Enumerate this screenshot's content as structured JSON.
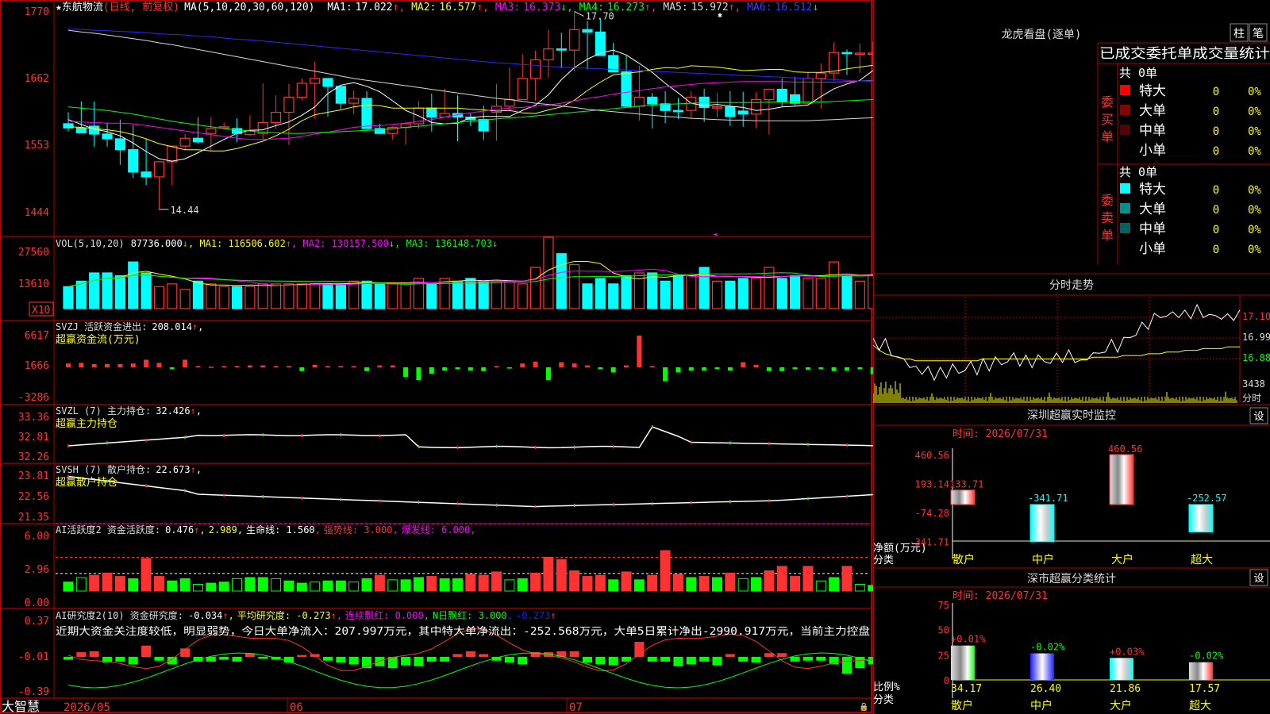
{
  "colors": {
    "red": "#ff3232",
    "cyan": "#00ffff",
    "green": "#00ff00",
    "yellow": "#ffff00",
    "magenta": "#ff00ff",
    "blue": "#1e1eff",
    "white": "#ffffff",
    "frame": "#b00000"
  },
  "main": {
    "title": "★东航物流",
    "mode": "(日线, 前复权)",
    "ma_label": "MA(5,10,20,30,60,120)",
    "ma": [
      {
        "label": "MA1:",
        "value": "17.022",
        "arrow": "↑"
      },
      {
        "label": "MA2:",
        "value": "16.577",
        "arrow": "↑"
      },
      {
        "label": "MA3:",
        "value": "16.373",
        "arrow": "↓"
      },
      {
        "label": "MA4:",
        "value": "16.273",
        "arrow": "↑"
      },
      {
        "label": "MA5:",
        "value": "15.972",
        "arrow": "↑"
      },
      {
        "label": "MA6:",
        "value": "16.512",
        "arrow": "↓"
      }
    ],
    "y_ticks": [
      "1770",
      "1662",
      "1553",
      "1444"
    ],
    "high_mark": "17.70",
    "low_mark": "14.44",
    "brand": "大智慧",
    "x_labels": [
      "2026/05",
      "06",
      "07"
    ]
  },
  "candles": {
    "o": [
      15.86,
      15.79,
      15.82,
      15.69,
      15.61,
      15.43,
      15.06,
      14.98,
      15.23,
      15.49,
      15.62,
      15.7,
      15.81,
      15.78,
      15.68,
      15.7,
      15.88,
      16.05,
      16.3,
      16.53,
      16.61,
      16.48,
      16.2,
      16.28,
      15.78,
      15.7,
      15.8,
      15.86,
      16.12,
      15.97,
      16.03,
      15.97,
      15.93,
      16.05,
      16.15,
      16.26,
      16.61,
      16.92,
      17.1,
      17.08,
      17.42,
      17.38,
      16.99,
      16.72,
      16.15,
      16.3,
      16.19,
      16.08,
      16.08,
      16.3,
      16.13,
      16.14,
      16.07,
      16.02,
      16.26,
      16.43,
      16.34,
      16.2,
      16.61,
      16.7,
      17.04,
      17.03,
      17.03,
      17.03,
      16.99
    ],
    "h": [
      16.05,
      16.23,
      16.23,
      15.88,
      15.93,
      15.84,
      15.61,
      15.1,
      15.3,
      15.69,
      15.97,
      15.97,
      15.88,
      15.95,
      16.0,
      16.53,
      16.33,
      16.52,
      16.61,
      16.89,
      16.61,
      16.48,
      16.41,
      16.4,
      15.86,
      15.82,
      15.89,
      16.24,
      16.36,
      16.44,
      16.33,
      16.03,
      16.16,
      16.52,
      16.79,
      17.01,
      17.07,
      17.42,
      17.37,
      17.72,
      17.56,
      17.61,
      17.2,
      16.99,
      16.82,
      16.37,
      16.4,
      16.29,
      16.4,
      16.44,
      16.37,
      16.4,
      16.39,
      16.38,
      16.37,
      16.61,
      16.64,
      16.71,
      16.86,
      17.21,
      17.09,
      17.19,
      17.22,
      17.32,
      17.19
    ],
    "l": [
      15.73,
      15.71,
      15.48,
      15.48,
      15.18,
      14.96,
      14.84,
      14.44,
      14.84,
      15.42,
      15.53,
      15.42,
      15.78,
      15.56,
      15.66,
      15.59,
      15.77,
      15.51,
      16.25,
      15.95,
      15.98,
      16.11,
      16.02,
      15.85,
      15.7,
      15.59,
      15.51,
      15.78,
      15.73,
      15.98,
      15.57,
      15.82,
      15.59,
      15.58,
      16.07,
      16.26,
      16.24,
      16.63,
      16.78,
      16.73,
      16.76,
      17.03,
      16.81,
      16.52,
      15.91,
      15.78,
      15.87,
      15.94,
      15.95,
      15.89,
      15.96,
      15.82,
      15.81,
      15.79,
      15.68,
      16.15,
      16.16,
      16.17,
      16.11,
      16.57,
      16.67,
      16.7,
      16.84,
      16.81,
      16.89
    ],
    "c": [
      15.79,
      15.71,
      15.69,
      15.61,
      15.43,
      15.06,
      14.98,
      15.23,
      15.49,
      15.62,
      15.56,
      15.78,
      15.81,
      15.7,
      15.75,
      15.88,
      16.05,
      16.3,
      16.53,
      16.61,
      16.48,
      16.2,
      16.28,
      15.78,
      15.7,
      15.8,
      15.86,
      16.12,
      15.97,
      16.03,
      15.97,
      15.93,
      15.74,
      16.15,
      16.26,
      16.61,
      16.92,
      17.1,
      17.08,
      17.42,
      17.38,
      16.99,
      16.72,
      16.15,
      16.3,
      16.19,
      16.08,
      16.06,
      16.3,
      16.13,
      16.14,
      15.98,
      16.02,
      16.26,
      16.43,
      16.23,
      16.2,
      16.61,
      16.7,
      17.04,
      17.03,
      17.03,
      17.03,
      16.99,
      17.09
    ]
  },
  "ma_lines": {
    "ma1": [
      15.93,
      15.85,
      15.77,
      15.73,
      15.66,
      15.54,
      15.4,
      15.28,
      15.24,
      15.28,
      15.38,
      15.49,
      15.6,
      15.7,
      15.75,
      15.76,
      15.83,
      15.89,
      16.0,
      16.14,
      16.36,
      16.5,
      16.54,
      16.48,
      16.39,
      16.24,
      16.08,
      15.99,
      15.88,
      15.86,
      15.87,
      15.96,
      15.98,
      15.98,
      15.98,
      16.08,
      16.17,
      16.34,
      16.59,
      16.79,
      16.93,
      17.03,
      17.08,
      17.0,
      16.86,
      16.71,
      16.53,
      16.37,
      16.2,
      16.16,
      16.18,
      16.15,
      16.13,
      16.08,
      16.1,
      16.14,
      16.15,
      16.17,
      16.31,
      16.44,
      16.52,
      16.58,
      16.74,
      16.88,
      16.99
    ],
    "ma2": [
      15.81,
      15.8,
      15.78,
      15.76,
      15.73,
      15.68,
      15.61,
      15.53,
      15.48,
      15.43,
      15.43,
      15.41,
      15.41,
      15.45,
      15.51,
      15.57,
      15.66,
      15.77,
      15.91,
      16.01,
      16.05,
      16.09,
      16.14,
      16.17,
      16.16,
      16.12,
      16.12,
      16.12,
      16.12,
      16.12,
      16.12,
      16.1,
      16.09,
      16.07,
      16.08,
      16.04,
      16.03,
      16.09,
      16.14,
      16.25,
      16.41,
      16.55,
      16.67,
      16.7,
      16.72,
      16.76,
      16.79,
      16.78,
      16.82,
      16.81,
      16.8,
      16.77,
      16.74,
      16.75,
      16.76,
      16.76,
      16.72,
      16.71,
      16.71,
      16.73,
      16.77,
      16.8,
      16.83,
      16.88,
      16.91
    ],
    "ma3": [
      15.9,
      15.89,
      15.88,
      15.87,
      15.87,
      15.86,
      15.83,
      15.8,
      15.77,
      15.74,
      15.71,
      15.68,
      15.65,
      15.62,
      15.6,
      15.6,
      15.61,
      15.62,
      15.65,
      15.69,
      15.72,
      15.76,
      15.8,
      15.82,
      15.83,
      15.85,
      15.87,
      15.9,
      15.93,
      15.97,
      16.01,
      16.04,
      16.07,
      16.1,
      16.12,
      16.13,
      16.15,
      16.17,
      16.2,
      16.24,
      16.28,
      16.31,
      16.35,
      16.38,
      16.41,
      16.44,
      16.47,
      16.49,
      16.51,
      16.53,
      16.54,
      16.55,
      16.56,
      16.56,
      16.56,
      16.56,
      16.55,
      16.55,
      16.55,
      16.55,
      16.56,
      16.57,
      16.58,
      16.59,
      16.6
    ],
    "ma4": [
      16.14,
      16.12,
      16.1,
      16.08,
      16.05,
      16.02,
      15.98,
      15.94,
      15.9,
      15.87,
      15.84,
      15.81,
      15.78,
      15.76,
      15.74,
      15.72,
      15.71,
      15.7,
      15.7,
      15.71,
      15.72,
      15.73,
      15.74,
      15.75,
      15.76,
      15.78,
      15.8,
      15.82,
      15.84,
      15.86,
      15.88,
      15.9,
      15.92,
      15.94,
      15.96,
      15.97,
      15.99,
      16.01,
      16.03,
      16.05,
      16.07,
      16.09,
      16.11,
      16.13,
      16.15,
      16.17,
      16.18,
      16.19,
      16.2,
      16.21,
      16.21,
      16.21,
      16.21,
      16.21,
      16.22,
      16.22,
      16.22,
      16.22,
      16.22,
      16.23,
      16.24,
      16.25,
      16.26,
      16.27,
      16.28
    ],
    "ma5": [
      17.41,
      17.38,
      17.36,
      17.33,
      17.3,
      17.27,
      17.24,
      17.2,
      17.17,
      17.13,
      17.09,
      17.05,
      17.01,
      16.97,
      16.93,
      16.89,
      16.85,
      16.81,
      16.77,
      16.73,
      16.69,
      16.65,
      16.61,
      16.58,
      16.55,
      16.52,
      16.49,
      16.46,
      16.43,
      16.4,
      16.37,
      16.34,
      16.31,
      16.28,
      16.26,
      16.23,
      16.2,
      16.18,
      16.15,
      16.13,
      16.1,
      16.08,
      16.06,
      16.04,
      16.02,
      16.0,
      15.98,
      15.97,
      15.95,
      15.94,
      15.93,
      15.92,
      15.92,
      15.91,
      15.91,
      15.91,
      15.91,
      15.91,
      15.92,
      15.93,
      15.94,
      15.95,
      15.96,
      15.97,
      15.98
    ],
    "ma6": [
      17.43,
      17.42,
      17.41,
      17.4,
      17.39,
      17.38,
      17.37,
      17.35,
      17.34,
      17.33,
      17.31,
      17.3,
      17.28,
      17.26,
      17.25,
      17.23,
      17.21,
      17.19,
      17.17,
      17.15,
      17.13,
      17.11,
      17.09,
      17.07,
      17.05,
      17.03,
      17.01,
      16.99,
      16.97,
      16.95,
      16.93,
      16.91,
      16.89,
      16.87,
      16.86,
      16.84,
      16.83,
      16.81,
      16.8,
      16.79,
      16.78,
      16.77,
      16.76,
      16.75,
      16.74,
      16.73,
      16.72,
      16.71,
      16.7,
      16.69,
      16.68,
      16.67,
      16.66,
      16.65,
      16.64,
      16.63,
      16.62,
      16.61,
      16.6,
      16.59,
      16.58,
      16.57,
      16.56,
      16.54,
      16.52
    ]
  },
  "vol_panel": {
    "title": "VOL(5,10,20)",
    "value": "87736.000",
    "arrow": "↓",
    "ma1": "MA1: 116506.602",
    "ma1_arrow": "↑",
    "ma2": "MA2: 130157.500",
    "ma2_arrow": "↓",
    "ma3": "MA3: 136148.703",
    "ma3_arrow": "↓",
    "y_ticks": [
      "27560",
      "13610"
    ],
    "unit": "X10",
    "values": [
      8,
      10,
      13,
      13,
      12,
      17,
      13,
      8,
      9,
      7,
      10,
      9,
      8,
      8,
      8,
      9,
      9,
      9,
      9,
      9,
      9,
      9,
      10,
      10,
      9,
      9,
      9,
      11,
      9,
      11,
      10,
      11,
      10,
      10,
      10,
      9,
      15,
      26,
      20,
      16,
      9,
      11,
      9,
      12,
      13,
      13,
      10,
      12,
      12,
      15,
      10,
      10,
      11,
      11,
      15,
      11,
      12,
      11,
      11,
      17,
      12,
      10,
      12,
      12,
      8
    ]
  },
  "svzj_panel": {
    "title": "SVZJ  活跃资金进出:",
    "value": "208.014",
    "arrow": "↑",
    "sub": "超赢资金流(万元)",
    "y_ticks": [
      "6617",
      "1666",
      "-3286"
    ],
    "values": [
      600,
      700,
      500,
      500,
      500,
      600,
      1200,
      700,
      -300,
      1200,
      200,
      100,
      200,
      200,
      300,
      300,
      200,
      200,
      -600,
      400,
      200,
      200,
      200,
      -600,
      300,
      300,
      -1500,
      -2000,
      -1000,
      -500,
      -300,
      -500,
      -600,
      200,
      -200,
      600,
      900,
      -2000,
      800,
      600,
      300,
      -300,
      -800,
      300,
      5000,
      200,
      -2200,
      -800,
      -500,
      -500,
      -300,
      -500,
      800,
      400,
      -600,
      -600,
      -300,
      -400,
      -300,
      -600,
      -500,
      -300,
      -1100,
      -1800,
      200
    ]
  },
  "svzl_panel": {
    "title": "SVZL (7) 主力持仓:",
    "value": "32.426",
    "arrow": "↑",
    "sub": "超赢主力持仓",
    "y_ticks": [
      "33.36",
      "32.81",
      "32.26"
    ]
  },
  "svsh_panel": {
    "title": "SVSH (7) 散户持仓:",
    "value": "22.673",
    "arrow": "↑",
    "sub": "超赢散户持仓",
    "y_ticks": [
      "23.81",
      "22.56",
      "21.35"
    ]
  },
  "ai_panel": {
    "title": "AI活跃度2 资金活跃度:",
    "value": "0.476",
    "arrow1": "↑",
    "value2": "2.989",
    "sep": ",",
    "life": "生命线: 1.560",
    "strong": "强势线: 3.000",
    "burst": "爆发线: 6.000",
    "y_ticks": [
      "6.00",
      "2.96",
      "0.00"
    ],
    "values": [
      0.8,
      1.2,
      1.4,
      1.6,
      1.3,
      1.1,
      2.9,
      1.3,
      0.9,
      1.1,
      0.6,
      0.7,
      0.8,
      1.1,
      1.2,
      1.2,
      1.1,
      0.9,
      0.7,
      0.8,
      0.9,
      0.9,
      0.8,
      1.1,
      1.4,
      1.0,
      1.0,
      1.2,
      1.3,
      1.1,
      1.1,
      1.5,
      1.4,
      1.7,
      1.0,
      1.1,
      1.6,
      3.0,
      2.8,
      1.8,
      1.3,
      1.4,
      1.0,
      1.7,
      1.0,
      1.4,
      3.6,
      1.5,
      1.2,
      1.3,
      1.2,
      1.6,
      1.1,
      1.2,
      1.8,
      2.2,
      1.3,
      2.2,
      0.9,
      1.2,
      2.2,
      0.6,
      0.5,
      0.6,
      0.5
    ]
  },
  "ai_research": {
    "title": "AI研究度2(10) 资金研究度:",
    "value": "-0.034",
    "arrow1": "↑",
    "avg": "平均研究度: -0.273",
    "arrow2": "↑",
    "streak": "连续飘红: 0.000",
    "nday": "N日飘红: 3.000",
    "neg": "-0.273",
    "arrow3": "↑",
    "comment": "近期大资金关注度较低，明显弱势，今日大单净流入：207.997万元，其中特大单净流出：-252.568万元，大单5日累计净出-2990.917万元，当前主力控盘",
    "y_ticks": [
      "0.37",
      "-0.01",
      "-0.39"
    ],
    "values": [
      -0.03,
      0.05,
      0.06,
      -0.06,
      -0.05,
      -0.08,
      0.12,
      -0.04,
      -0.08,
      0.09,
      -0.05,
      -0.05,
      -0.03,
      -0.05,
      0.04,
      -0.02,
      -0.03,
      -0.06,
      0.02,
      0.03,
      -0.04,
      -0.06,
      -0.08,
      -0.12,
      -0.1,
      -0.12,
      -0.09,
      -0.1,
      -0.05,
      -0.05,
      0.03,
      0.06,
      0.03,
      -0.04,
      -0.06,
      -0.08,
      0.05,
      0.05,
      0.06,
      0.06,
      -0.06,
      -0.08,
      -0.09,
      -0.05,
      0.16,
      -0.05,
      -0.05,
      -0.1,
      -0.08,
      -0.05,
      -0.09,
      0.03,
      -0.05,
      -0.06,
      0.04,
      0.04,
      -0.05,
      -0.04,
      -0.04,
      -0.08,
      -0.18,
      -0.12,
      -0.08,
      -0.06,
      -0.05
    ]
  },
  "lhb": {
    "title": "龙虎看盘(逐单)",
    "btn_zhu": "柱",
    "btn_bi": "笔",
    "header": "已成交委托单成交量统计",
    "buy_total": "共 0单",
    "sell_total": "共 0单",
    "buy_label": "委买单",
    "sell_label": "委卖单",
    "rows": [
      {
        "label": "特大",
        "count": "0",
        "pct": "0%"
      },
      {
        "label": "大单",
        "count": "0",
        "pct": "0%"
      },
      {
        "label": "中单",
        "count": "0",
        "pct": "0%"
      },
      {
        "label": "小单",
        "count": "0",
        "pct": "0%"
      }
    ],
    "buy_colors": [
      "#ff0000",
      "#8b0000",
      "#5a0000",
      ""
    ],
    "sell_colors": [
      "#00ffff",
      "#009090",
      "#006464",
      ""
    ]
  },
  "intraday": {
    "title": "分时走势",
    "y_ticks": [
      "17.10",
      "16.99",
      "16.88"
    ],
    "vol_label": "3438",
    "vol_unit": "分时",
    "price": [
      16.98,
      16.92,
      16.96,
      16.9,
      16.85,
      16.88,
      16.8,
      16.82,
      16.78,
      16.8,
      16.76,
      16.79,
      16.77,
      16.82,
      16.78,
      16.8,
      16.83,
      16.79,
      16.84,
      16.81,
      16.86,
      16.83,
      16.85,
      16.88,
      16.84,
      16.86,
      16.83,
      16.87,
      16.85,
      16.84,
      16.88,
      16.86,
      16.89,
      16.86,
      16.84,
      16.86,
      16.9,
      16.88,
      16.92,
      16.95,
      16.92,
      16.97,
      16.99,
      17.0,
      17.06,
      17.05,
      17.1,
      17.12,
      17.09,
      17.14,
      17.1,
      17.13,
      17.11,
      17.15,
      17.12,
      17.1,
      17.12,
      17.09,
      17.11,
      17.1,
      17.12
    ],
    "avg": [
      16.94,
      16.91,
      16.89,
      16.88,
      16.87,
      16.86,
      16.86,
      16.85,
      16.85,
      16.85,
      16.85,
      16.85,
      16.85,
      16.85,
      16.85,
      16.85,
      16.85,
      16.85,
      16.86,
      16.86,
      16.86,
      16.86,
      16.86,
      16.86,
      16.86,
      16.86,
      16.86,
      16.86,
      16.86,
      16.86,
      16.86,
      16.86,
      16.86,
      16.86,
      16.86,
      16.86,
      16.87,
      16.87,
      16.87,
      16.87,
      16.87,
      16.88,
      16.88,
      16.88,
      16.88,
      16.89,
      16.89,
      16.89,
      16.9,
      16.9,
      16.9,
      16.91,
      16.91,
      16.91,
      16.92,
      16.92,
      16.92,
      16.92,
      16.93,
      16.93,
      16.93
    ]
  },
  "monitor": {
    "title": "深圳超赢实时监控",
    "btn": "设",
    "time": "时间: 2026/07/31",
    "y_ticks": [
      "460.56",
      "193.14",
      "-74.28",
      "-341.71"
    ],
    "ylabel1": "净额(万元)",
    "ylabel2": "分类",
    "categories": [
      "散户",
      "中户",
      "大户",
      "超大"
    ],
    "values": [
      133.71,
      -341.71,
      460.56,
      -252.57
    ],
    "value_labels": [
      "133.71",
      "-341.71",
      "460.56",
      "-252.57"
    ]
  },
  "stats": {
    "title": "深市超赢分类统计",
    "btn": "设",
    "time": "时间: 2026/07/31",
    "y_ticks": [
      "75",
      "50",
      "25",
      "0"
    ],
    "ylabel1": "比例%",
    "ylabel2": "分类",
    "categories": [
      "散户",
      "中户",
      "大户",
      "超大"
    ],
    "values": [
      34.17,
      26.4,
      21.86,
      17.57
    ],
    "value_labels": [
      "34.17",
      "26.40",
      "21.86",
      "17.57"
    ],
    "changes": [
      "+0.01%",
      "-0.02%",
      "+0.03%",
      "-0.02%"
    ]
  }
}
